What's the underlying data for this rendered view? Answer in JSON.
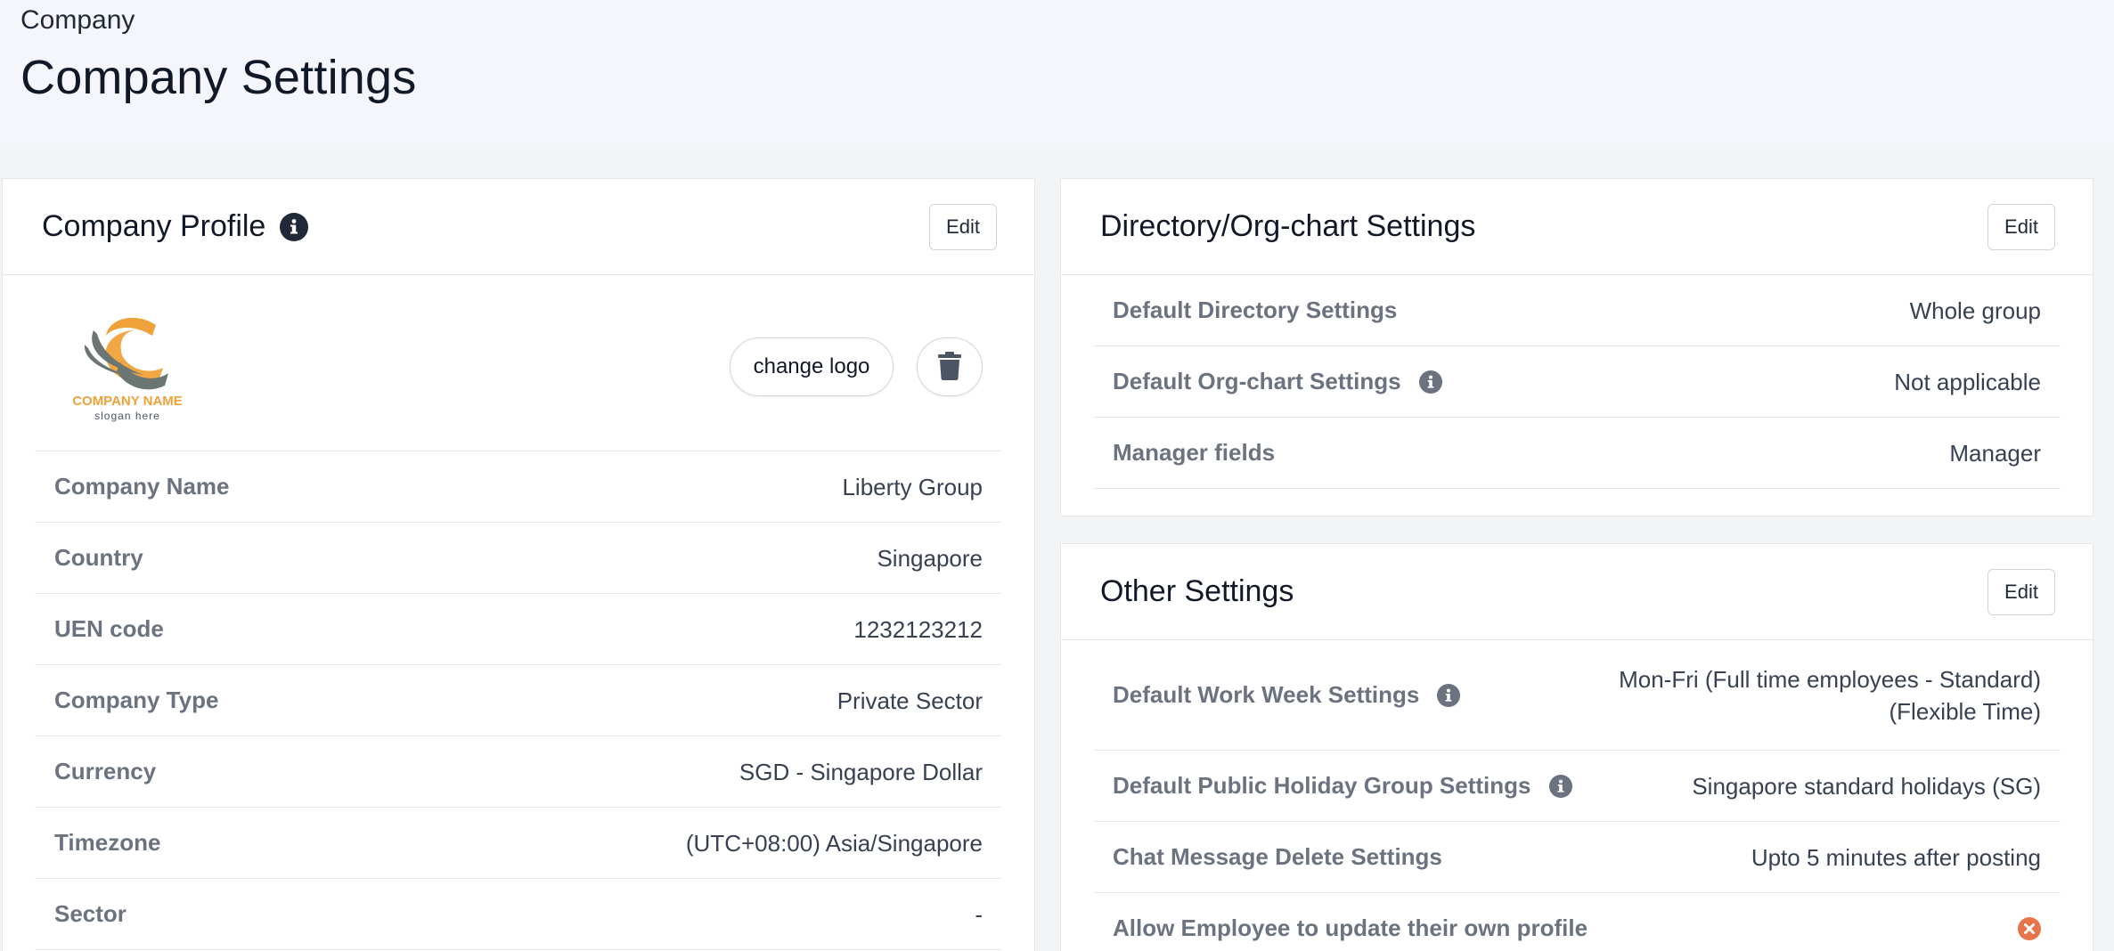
{
  "header": {
    "breadcrumb": "Company",
    "title": "Company Settings"
  },
  "profile": {
    "title": "Company Profile",
    "edit_label": "Edit",
    "logo_text": {
      "name": "COMPANY NAME",
      "slogan": "slogan here"
    },
    "change_logo_label": "change logo",
    "rows": [
      {
        "label": "Company Name",
        "value": "Liberty Group"
      },
      {
        "label": "Country",
        "value": "Singapore"
      },
      {
        "label": "UEN code",
        "value": "1232123212"
      },
      {
        "label": "Company Type",
        "value": "Private Sector"
      },
      {
        "label": "Currency",
        "value": "SGD - Singapore Dollar"
      },
      {
        "label": "Timezone",
        "value": "(UTC+08:00) Asia/Singapore"
      },
      {
        "label": "Sector",
        "value": "-"
      }
    ]
  },
  "directory": {
    "title": "Directory/Org-chart Settings",
    "edit_label": "Edit",
    "rows": [
      {
        "label": "Default Directory Settings",
        "value": "Whole group"
      },
      {
        "label": "Default Org-chart Settings",
        "value": "Not applicable"
      },
      {
        "label": "Manager fields",
        "value": "Manager"
      }
    ]
  },
  "other": {
    "title": "Other Settings",
    "edit_label": "Edit",
    "rows": [
      {
        "label": "Default Work Week Settings",
        "value_line1": "Mon-Fri (Full time employees - Standard)",
        "value_line2": "(Flexible Time)"
      },
      {
        "label": "Default Public Holiday Group Settings",
        "value": "Singapore standard holidays (SG)"
      },
      {
        "label": "Chat Message Delete Settings",
        "value": "Upto 5 minutes after posting"
      },
      {
        "label": "Allow Employee to update their own profile",
        "status": "disabled"
      }
    ]
  },
  "colors": {
    "accent_orange": "#f0a23a",
    "logo_grey": "#6b7673",
    "disabled_badge": "#e8754a"
  }
}
